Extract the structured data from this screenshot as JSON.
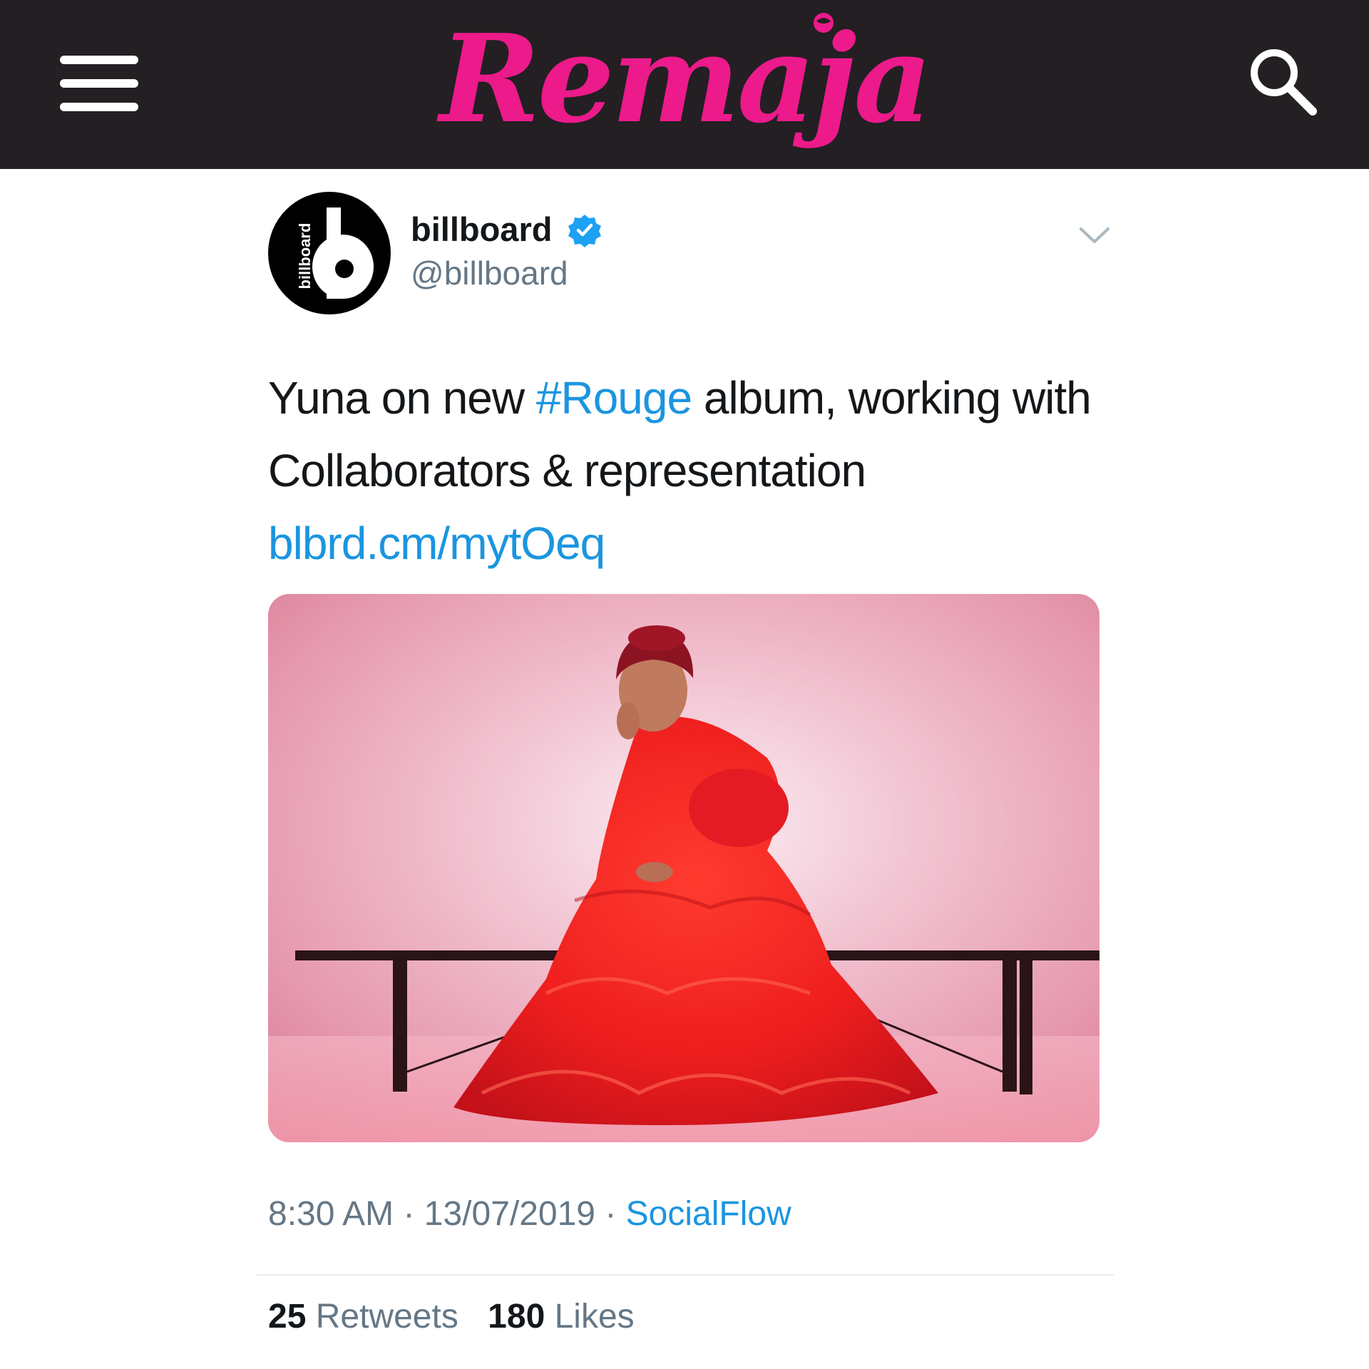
{
  "header": {
    "logo_text": "Remaja",
    "logo_color": "#ec1a8b",
    "background": "#231f22",
    "menu_icon": "hamburger-menu-icon",
    "search_icon": "search-icon"
  },
  "tweet": {
    "avatar_label": "billboard",
    "display_name": "billboard",
    "verified": true,
    "handle": "@billboard",
    "text_part1": "Yuna on new ",
    "hashtag": "#Rouge",
    "text_part2": " album, working with Collaborators & representation ",
    "link": "blbrd.cm/mytOeq",
    "time": "8:30 AM",
    "date": "13/07/2019",
    "separator": " · ",
    "source": "SocialFlow",
    "retweets_count": "25",
    "retweets_label": "Retweets",
    "likes_count": "180",
    "likes_label": "Likes"
  },
  "colors": {
    "link": "#1b95e0",
    "text": "#14171a",
    "secondary": "#657786"
  }
}
